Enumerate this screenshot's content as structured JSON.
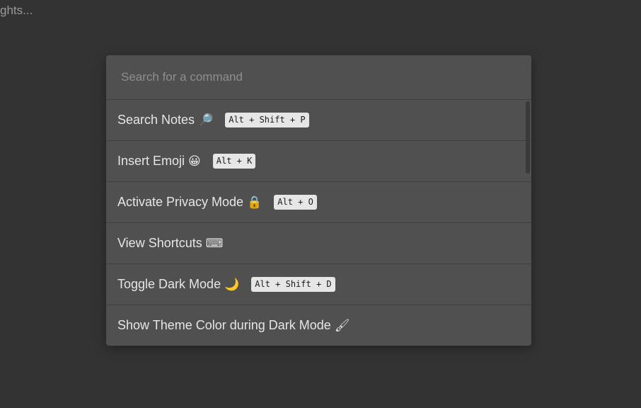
{
  "background": {
    "text": "ghts..."
  },
  "search": {
    "placeholder": "Search for a command"
  },
  "commands": [
    {
      "label": "Search Notes",
      "emoji": "🔎",
      "shortcut": "Alt + Shift + P",
      "icon": "magnifier-icon"
    },
    {
      "label": "Insert Emoji",
      "emoji": "😀",
      "shortcut": "Alt + K",
      "icon": "smiley-icon"
    },
    {
      "label": "Activate Privacy Mode",
      "emoji": "🔒",
      "shortcut": "Alt + O",
      "icon": "lock-icon"
    },
    {
      "label": "View Shortcuts",
      "emoji": "⌨",
      "shortcut": "",
      "icon": "keyboard-icon"
    },
    {
      "label": "Toggle Dark Mode",
      "emoji": "🌙",
      "shortcut": "Alt + Shift + D",
      "icon": "moon-icon"
    },
    {
      "label": "Show Theme Color during Dark Mode",
      "emoji": "🖌",
      "shortcut": "",
      "icon": "paintbrush-icon"
    }
  ],
  "colors": {
    "page_background": "#333333",
    "palette_background": "#505050",
    "shortcut_badge": "#e6e6e6"
  }
}
